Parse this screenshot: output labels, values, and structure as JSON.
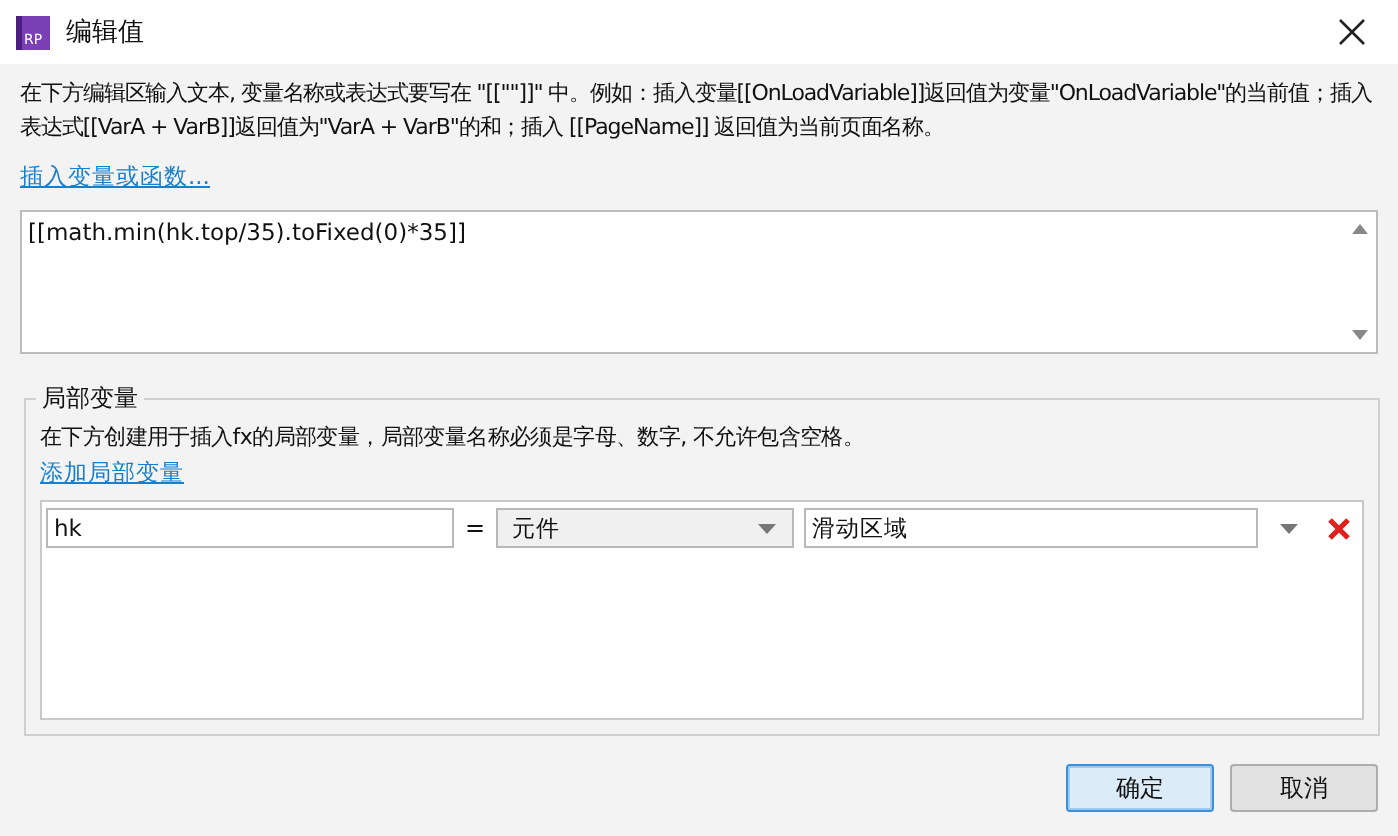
{
  "window": {
    "title": "编辑值",
    "icon_text": "RP"
  },
  "description": "在下方编辑区输入文本, 变量名称或表达式要写在 \"[[\"\"]]\" 中。例如：插入变量[[OnLoadVariable]]返回值为变量\"OnLoadVariable\"的当前值；插入表达式[[VarA + VarB]]返回值为\"VarA + VarB\"的和；插入 [[PageName]] 返回值为当前页面名称。",
  "insert_link": "插入变量或函数...",
  "expression": "[[math.min(hk.top/35).toFixed(0)*35]]",
  "local_variables": {
    "legend": "局部变量",
    "description": "在下方创建用于插入fx的局部变量，局部变量名称必须是字母、数字, 不允许包含空格。",
    "add_link": "添加局部变量",
    "variables": [
      {
        "name": "hk",
        "equals": "=",
        "type": "元件",
        "target": "滑动区域"
      }
    ]
  },
  "buttons": [
    {
      "label": "确定",
      "default": true
    },
    {
      "label": "取消",
      "default": false
    }
  ]
}
